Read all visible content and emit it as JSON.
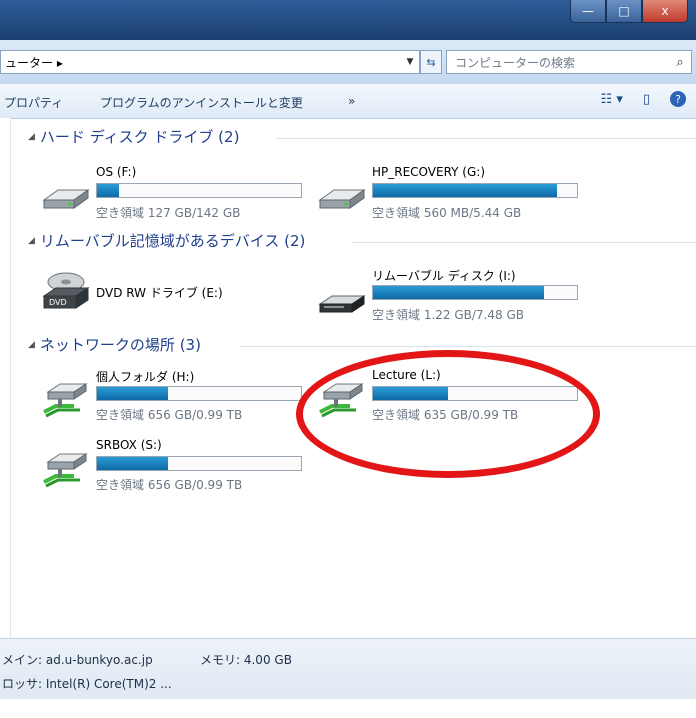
{
  "window": {
    "min_glyph": "—",
    "max_glyph": "□",
    "close_glyph": "x"
  },
  "address": {
    "path": "ューター ▸",
    "search_placeholder": "コンピューターの検索"
  },
  "toolbar": {
    "properties": "プロパティ",
    "uninstall": "プログラムのアンインストールと変更",
    "more": "»"
  },
  "groups": [
    {
      "title": "ハード ディスク ドライブ (2)"
    },
    {
      "title": "リムーバブル記憶域があるデバイス (2)"
    },
    {
      "title": "ネットワークの場所 (3)"
    }
  ],
  "drives": [
    {
      "name": "OS (F:)",
      "space": "空き領域 127 GB/142 GB",
      "used_fraction": 0.11,
      "icon": "hard-drive-icon"
    },
    {
      "name": "HP_RECOVERY (G:)",
      "space": "空き領域 560 MB/5.44 GB",
      "used_fraction": 0.9,
      "icon": "hard-drive-icon"
    },
    {
      "name": "DVD RW ドライブ (E:)",
      "icon": "dvd-drive-icon"
    },
    {
      "name": "リムーバブル ディスク (I:)",
      "space": "空き領域 1.22 GB/7.48 GB",
      "used_fraction": 0.84,
      "icon": "removable-disk-icon"
    },
    {
      "name": "個人フォルダ (H:)",
      "space": "空き領域 656 GB/0.99 TB",
      "used_fraction": 0.35,
      "icon": "network-drive-icon"
    },
    {
      "name": "Lecture (L:)",
      "space": "空き領域 635 GB/0.99 TB",
      "used_fraction": 0.37,
      "icon": "network-drive-icon"
    },
    {
      "name": "SRBOX (S:)",
      "space": "空き領域 656 GB/0.99 TB",
      "used_fraction": 0.35,
      "icon": "network-drive-icon"
    }
  ],
  "status": {
    "domain": "メイン: ad.u-bunkyo.ac.jp",
    "memory": "メモリ: 4.00 GB",
    "processor": "ロッサ: Intel(R) Core(TM)2 ..."
  },
  "colors": {
    "bar_fill": "#1a83c2",
    "group_title": "#1f3f8f",
    "annotation_circle": "#e21616"
  }
}
